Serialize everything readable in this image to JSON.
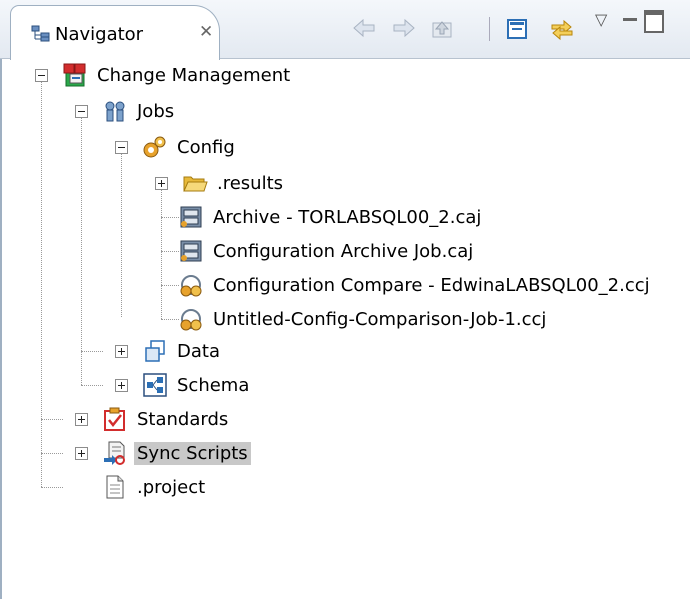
{
  "panel": {
    "tab_title": "Navigator",
    "close_glyph": "✕"
  },
  "toolbar": {
    "icons": [
      "back-icon",
      "forward-icon",
      "up-icon",
      "collapse-all-icon",
      "link-with-editor-icon",
      "view-menu-icon",
      "minimize-icon",
      "maximize-icon"
    ]
  },
  "tree": {
    "nodes": [
      {
        "label": "Change Management",
        "icon": "project-icon",
        "expanded": true
      },
      {
        "label": "Jobs",
        "icon": "jobs-icon",
        "expanded": true
      },
      {
        "label": "Config",
        "icon": "config-icon",
        "expanded": true
      },
      {
        "label": ".results",
        "icon": "folder-icon",
        "expanded": false
      },
      {
        "label": "Archive - TORLABSQL00_2.caj",
        "icon": "archive-job-icon"
      },
      {
        "label": "Configuration Archive Job.caj",
        "icon": "archive-job-icon"
      },
      {
        "label": "Configuration Compare - EdwinaLABSQL00_2.ccj",
        "icon": "compare-job-icon"
      },
      {
        "label": "Untitled-Config-Comparison-Job-1.ccj",
        "icon": "compare-job-icon"
      },
      {
        "label": "Data",
        "icon": "data-icon",
        "expanded": false
      },
      {
        "label": "Schema",
        "icon": "schema-icon",
        "expanded": false
      },
      {
        "label": "Standards",
        "icon": "standards-icon",
        "expanded": false
      },
      {
        "label": "Sync Scripts",
        "icon": "sync-scripts-icon",
        "expanded": false,
        "selected": true
      },
      {
        "label": ".project",
        "icon": "file-icon"
      }
    ]
  },
  "colors": {
    "selection": "#c8c8c8",
    "folder": "#f2c94c",
    "accent_red": "#d22d2d",
    "accent_blue": "#2c6fb5"
  }
}
